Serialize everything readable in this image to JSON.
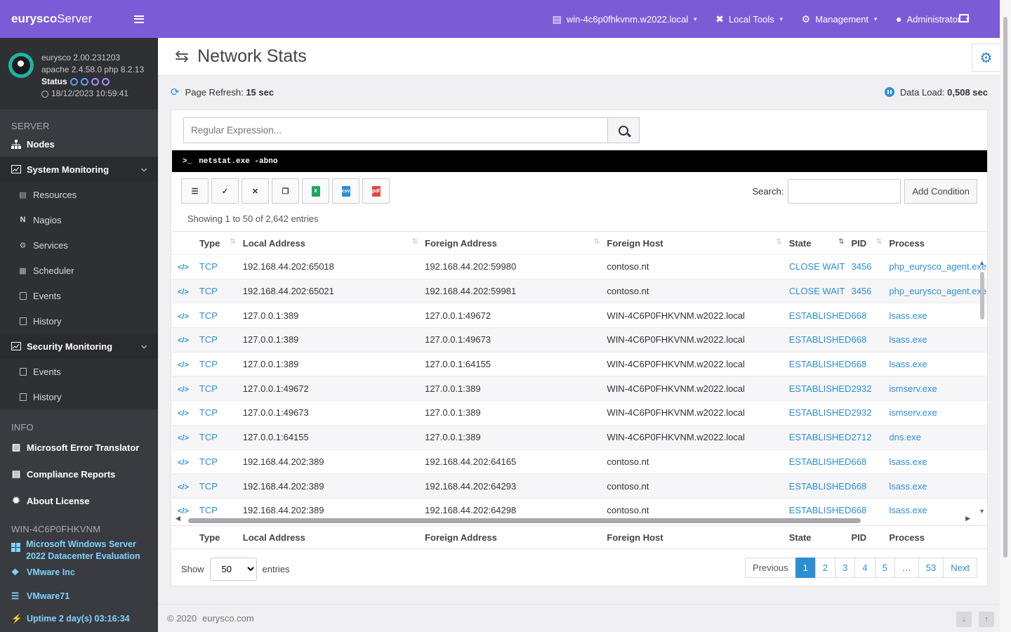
{
  "brand": {
    "bold": "eurysco",
    "rest": "Server"
  },
  "server": {
    "version": "eurysco 2.00.231203",
    "stack": "apache 2.4.58.0  php 8.2.13",
    "status_label": "Status",
    "datetime": "18/12/2023 10:59:41"
  },
  "nav": {
    "server_section": "SERVER",
    "nodes": "Nodes",
    "system_monitoring": "System Monitoring",
    "system_items": [
      "Resources",
      "Nagios",
      "Services",
      "Scheduler",
      "Events",
      "History"
    ],
    "security_monitoring": "Security Monitoring",
    "security_items": [
      "Events",
      "History"
    ],
    "info_section": "INFO",
    "error_translator": "Microsoft Error Translator",
    "compliance": "Compliance Reports",
    "license": "About License",
    "host_section": "WIN-4C6P0FHKVNM",
    "os": "Microsoft Windows Server 2022 Datacenter Evaluation",
    "vendor": "VMware Inc",
    "model": "VMware71",
    "uptime": "Uptime 2 day(s) 03:16:34"
  },
  "topbar": {
    "host": "win-4c6p0fhkvnm.w2022.local",
    "local_tools": "Local Tools",
    "management": "Management",
    "user": "Administrator"
  },
  "page": {
    "title": "Network Stats",
    "refresh_label": "Page Refresh:",
    "refresh_value": "15 sec",
    "load_label": "Data Load:",
    "load_value": "0,508 sec"
  },
  "filter": {
    "placeholder": "Regular Expression..."
  },
  "command": "netstat.exe -abno",
  "toolbar": {
    "search_label": "Search:",
    "add_condition": "Add Condition",
    "showing": "Showing 1 to 50 of 2,642 entries"
  },
  "columns": [
    "Type",
    "Local Address",
    "Foreign Address",
    "Foreign Host",
    "State",
    "PID",
    "Process"
  ],
  "rows": [
    {
      "type": "TCP",
      "local": "192.168.44.202:65018",
      "foreign": "192.168.44.202:59980",
      "host": "contoso.nt",
      "state": "CLOSE WAIT",
      "pid": "3456",
      "process": "php_eurysco_agent.exe"
    },
    {
      "type": "TCP",
      "local": "192.168.44.202:65021",
      "foreign": "192.168.44.202:59981",
      "host": "contoso.nt",
      "state": "CLOSE WAIT",
      "pid": "3456",
      "process": "php_eurysco_agent.exe"
    },
    {
      "type": "TCP",
      "local": "127.0.0.1:389",
      "foreign": "127.0.0.1:49672",
      "host": "WIN-4C6P0FHKVNM.w2022.local",
      "state": "ESTABLISHED",
      "pid": "668",
      "process": "lsass.exe"
    },
    {
      "type": "TCP",
      "local": "127.0.0.1:389",
      "foreign": "127.0.0.1:49673",
      "host": "WIN-4C6P0FHKVNM.w2022.local",
      "state": "ESTABLISHED",
      "pid": "668",
      "process": "lsass.exe"
    },
    {
      "type": "TCP",
      "local": "127.0.0.1:389",
      "foreign": "127.0.0.1:64155",
      "host": "WIN-4C6P0FHKVNM.w2022.local",
      "state": "ESTABLISHED",
      "pid": "668",
      "process": "lsass.exe"
    },
    {
      "type": "TCP",
      "local": "127.0.0.1:49672",
      "foreign": "127.0.0.1:389",
      "host": "WIN-4C6P0FHKVNM.w2022.local",
      "state": "ESTABLISHED",
      "pid": "2932",
      "process": "ismserv.exe"
    },
    {
      "type": "TCP",
      "local": "127.0.0.1:49673",
      "foreign": "127.0.0.1:389",
      "host": "WIN-4C6P0FHKVNM.w2022.local",
      "state": "ESTABLISHED",
      "pid": "2932",
      "process": "ismserv.exe"
    },
    {
      "type": "TCP",
      "local": "127.0.0.1:64155",
      "foreign": "127.0.0.1:389",
      "host": "WIN-4C6P0FHKVNM.w2022.local",
      "state": "ESTABLISHED",
      "pid": "2712",
      "process": "dns.exe"
    },
    {
      "type": "TCP",
      "local": "192.168.44.202:389",
      "foreign": "192.168.44.202:64165",
      "host": "contoso.nt",
      "state": "ESTABLISHED",
      "pid": "668",
      "process": "lsass.exe"
    },
    {
      "type": "TCP",
      "local": "192.168.44.202:389",
      "foreign": "192.168.44.202:64293",
      "host": "contoso.nt",
      "state": "ESTABLISHED",
      "pid": "668",
      "process": "lsass.exe"
    },
    {
      "type": "TCP",
      "local": "192.168.44.202:389",
      "foreign": "192.168.44.202:64298",
      "host": "contoso.nt",
      "state": "ESTABLISHED",
      "pid": "668",
      "process": "lsass.exe"
    }
  ],
  "length": {
    "show": "Show",
    "value": "50",
    "entries": "entries"
  },
  "pager": [
    "Previous",
    "1",
    "2",
    "3",
    "4",
    "5",
    "…",
    "53",
    "Next"
  ],
  "footer": {
    "copyright": "© 2020",
    "link": "eurysco.com"
  },
  "colors": {
    "accent": "#7c5cd6",
    "link": "#2b8fd6",
    "sidebar": "#3a3b40"
  }
}
